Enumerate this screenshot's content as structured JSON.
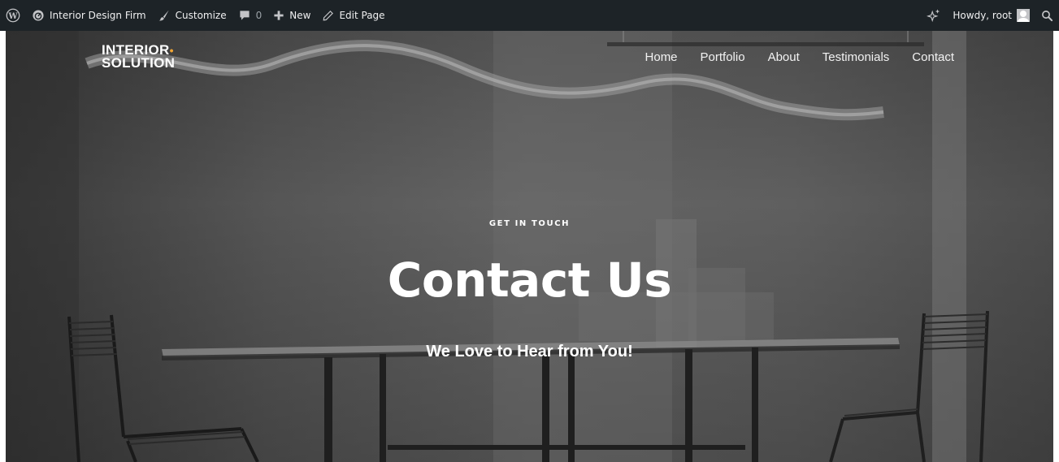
{
  "admin_bar": {
    "site_name": "Interior Design Firm",
    "customize": "Customize",
    "comments_count": "0",
    "new": "New",
    "edit_page": "Edit Page",
    "greeting": "Howdy, root"
  },
  "header": {
    "logo_line1": "INTERIOR",
    "logo_line2": "SOLUTION",
    "nav": [
      "Home",
      "Portfolio",
      "About",
      "Testimonials",
      "Contact"
    ]
  },
  "hero": {
    "eyebrow": "GET IN TOUCH",
    "title": "Contact Us",
    "subtitle": "We Love to Hear from You!"
  },
  "colors": {
    "admin_bar_bg": "#1d2327",
    "logo_accent": "#f0a534",
    "hero_text": "#ffffff"
  }
}
